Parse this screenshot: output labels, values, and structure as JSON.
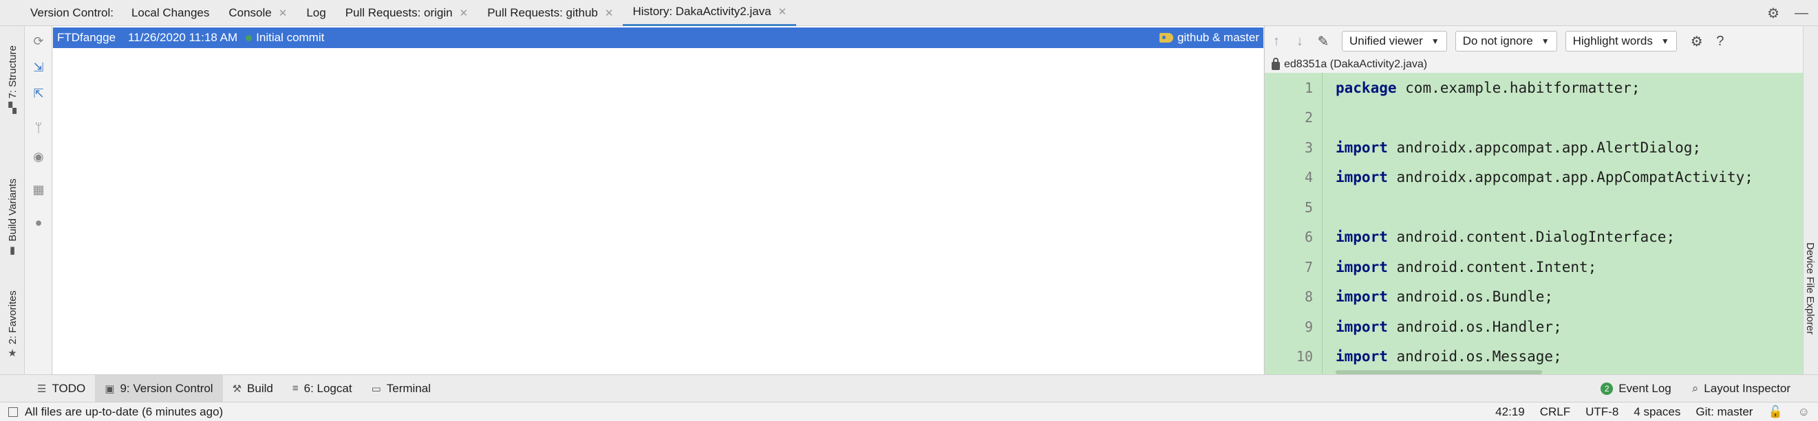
{
  "top_tabs": {
    "label": "Version Control:",
    "tabs": [
      {
        "label": "Local Changes",
        "closable": false
      },
      {
        "label": "Console",
        "closable": true
      },
      {
        "label": "Log",
        "closable": false
      },
      {
        "label": "Pull Requests: origin",
        "closable": true
      },
      {
        "label": "Pull Requests: github",
        "closable": true
      },
      {
        "label": "History: DakaActivity2.java",
        "closable": true,
        "active": true
      }
    ],
    "right_icons": [
      "gear-icon",
      "minimize-icon"
    ]
  },
  "left_stripe": {
    "items": [
      {
        "label": "7: Structure",
        "icon": "structure-icon"
      },
      {
        "label": "Build Variants",
        "icon": "build-variants-icon"
      },
      {
        "label": "2: Favorites",
        "icon": "star-icon"
      }
    ]
  },
  "vcs_toolbar": [
    "refresh-icon",
    "collapse-icon",
    "expand-icon",
    "branch-icon",
    "eye-icon",
    "layout-icon",
    "github-icon"
  ],
  "commit": {
    "author": "FTDfangge",
    "date": "11/26/2020 11:18 AM",
    "message": "Initial commit",
    "refs": "github & master"
  },
  "diff": {
    "viewer_mode": "Unified viewer",
    "ignore_mode": "Do not ignore",
    "highlight_mode": "Highlight words",
    "path": "ed8351a (DakaActivity2.java)",
    "lines": [
      {
        "n": "1",
        "kw": "package",
        "rest": " com.example.habitformatter;"
      },
      {
        "n": "2",
        "kw": "",
        "rest": ""
      },
      {
        "n": "3",
        "kw": "import",
        "rest": " androidx.appcompat.app.AlertDialog;"
      },
      {
        "n": "4",
        "kw": "import",
        "rest": " androidx.appcompat.app.AppCompatActivity;"
      },
      {
        "n": "5",
        "kw": "",
        "rest": ""
      },
      {
        "n": "6",
        "kw": "import",
        "rest": " android.content.DialogInterface;"
      },
      {
        "n": "7",
        "kw": "import",
        "rest": " android.content.Intent;"
      },
      {
        "n": "8",
        "kw": "import",
        "rest": " android.os.Bundle;"
      },
      {
        "n": "9",
        "kw": "import",
        "rest": " android.os.Handler;"
      },
      {
        "n": "10",
        "kw": "import",
        "rest": " android.os.Message;"
      }
    ]
  },
  "right_stripe": {
    "label": "Device File Explorer"
  },
  "bottom_tools": {
    "left": [
      {
        "label": "TODO",
        "icon": "list-icon"
      },
      {
        "label": "9: Version Control",
        "icon": "vcs-icon",
        "active": true
      },
      {
        "label": "Build",
        "icon": "hammer-icon"
      },
      {
        "label": "6: Logcat",
        "icon": "logcat-icon"
      },
      {
        "label": "Terminal",
        "icon": "terminal-icon"
      }
    ],
    "event_log": {
      "count": "2",
      "label": "Event Log"
    },
    "layout_inspector": "Layout Inspector"
  },
  "status_bar": {
    "message": "All files are up-to-date (6 minutes ago)",
    "position": "42:19",
    "line_sep": "CRLF",
    "encoding": "UTF-8",
    "indent": "4 spaces",
    "branch": "Git: master"
  },
  "colors": {
    "selection": "#3a73d4",
    "diff_added": "#c6e7c6",
    "keyword": "#00147a",
    "tab_underline": "#4083c9"
  }
}
